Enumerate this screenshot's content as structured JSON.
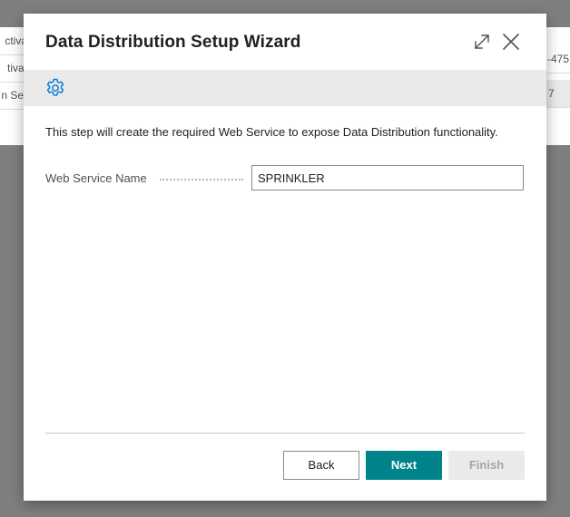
{
  "background": {
    "left_rows": [
      "ctiva",
      "tivat",
      "n Ser"
    ],
    "right_rows": [
      "-475",
      "7"
    ]
  },
  "dialog": {
    "title": "Data Distribution Setup Wizard",
    "expand_icon": "expand-icon",
    "close_icon": "close-icon",
    "toolbar_icon": "gear-icon",
    "instruction": "This step will create the required Web Service to expose Data Distribution functionality.",
    "field": {
      "label": "Web Service Name",
      "value": "SPRINKLER"
    },
    "buttons": {
      "back": "Back",
      "next": "Next",
      "finish": "Finish"
    }
  },
  "colors": {
    "accent": "#008489",
    "icon_blue": "#0078d4",
    "toolbar_bg": "#eaeaea",
    "overlay": "#7f7f7f"
  }
}
